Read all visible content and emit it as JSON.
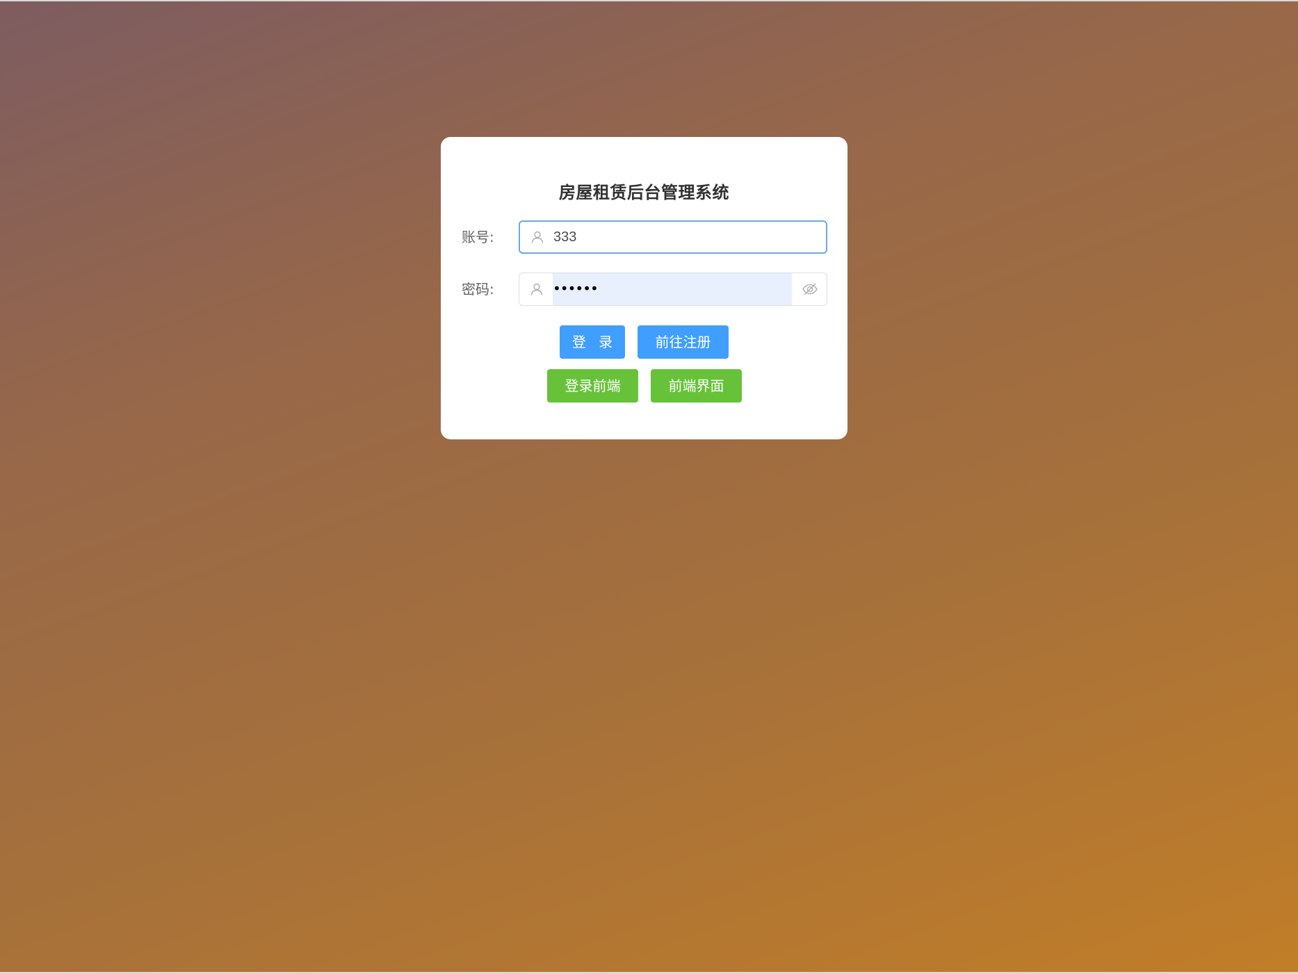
{
  "login": {
    "title": "房屋租赁后台管理系统",
    "account": {
      "label": "账号:",
      "value": "333",
      "icon": "user-icon"
    },
    "password": {
      "label": "密码:",
      "masked_value": "••••••",
      "icon": "user-icon",
      "toggle_icon": "eye-hidden-icon"
    },
    "buttons": {
      "login": "登 录",
      "register": "前往注册",
      "front_login": "登录前端",
      "front_page": "前端界面"
    }
  },
  "colors": {
    "primary": "#409eff",
    "success": "#67c23a",
    "focus_border": "#6aa9de",
    "autofill_bg": "#e8f0fe"
  }
}
